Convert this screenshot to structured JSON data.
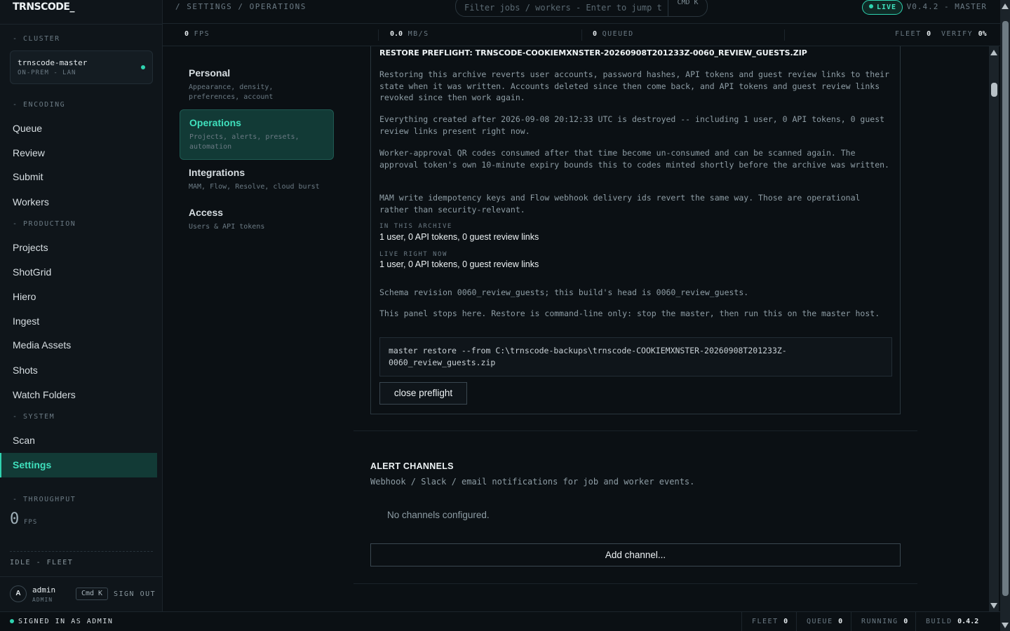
{
  "app": {
    "logo": "TRNSCODE_"
  },
  "sidebar": {
    "cluster_label": "- CLUSTER",
    "cluster_name": "trnscode-master",
    "cluster_sub": "ON-PREM - LAN",
    "encoding_label": "- ENCODING",
    "encoding_items": [
      "Queue",
      "Review",
      "Submit",
      "Workers"
    ],
    "production_label": "- PRODUCTION",
    "production_items": [
      "Projects",
      "ShotGrid",
      "Hiero",
      "Ingest",
      "Media Assets",
      "Shots",
      "Watch Folders"
    ],
    "system_label": "- SYSTEM",
    "system_items": [
      "Scan",
      "Settings"
    ],
    "throughput_label": "- THROUGHPUT",
    "throughput_value": "0",
    "throughput_unit": "FPS",
    "fleet_status": "IDLE - FLEET",
    "user": {
      "initial": "A",
      "name": "admin",
      "role": "ADMIN",
      "shortcut": "Cmd K",
      "signout": "SIGN OUT"
    }
  },
  "topbar": {
    "breadcrumb": "/ SETTINGS / OPERATIONS",
    "search_placeholder": "Filter jobs / workers - Enter to jump t",
    "search_shortcut": "CMD K",
    "live_label": "LIVE",
    "version": "V0.4.2 - MASTER"
  },
  "stats": {
    "fps_value": "0",
    "fps_label": "FPS",
    "mbs_value": "0.0",
    "mbs_label": "MB/S",
    "queued_value": "0",
    "queued_label": "QUEUED",
    "fleet_label": "FLEET",
    "fleet_value": "0",
    "verify_label": "VERIFY",
    "verify_value": "0%"
  },
  "settings_nav": [
    {
      "title": "Personal",
      "sub": "Appearance, density, preferences, account"
    },
    {
      "title": "Operations",
      "sub": "Projects, alerts, presets, automation"
    },
    {
      "title": "Integrations",
      "sub": "MAM, Flow, Resolve, cloud burst"
    },
    {
      "title": "Access",
      "sub": "Users & API tokens"
    }
  ],
  "preflight": {
    "title": "RESTORE PREFLIGHT: TRNSCODE-COOKIEMXNSTER-20260908T201233Z-0060_REVIEW_GUESTS.ZIP",
    "p1": "Restoring this archive reverts user accounts, password hashes, API tokens and guest review links to their state when it was written. Accounts deleted since then come back, and API tokens and guest review links revoked since then work again.",
    "p2": "Everything created after 2026-09-08 20:12:33 UTC is destroyed -- including 1 user, 0 API tokens, 0 guest review links present right now.",
    "p3": "Worker-approval QR codes consumed after that time become un-consumed and can be scanned again. The approval token's own 10-minute expiry bounds this to codes minted shortly before the archive was written.",
    "p4": "MAM write idempotency keys and Flow webhook delivery ids revert the same way. Those are operational rather than security-relevant.",
    "archive_label": "IN THIS ARCHIVE",
    "archive_value": "1 user, 0 API tokens, 0 guest review links",
    "live_label": "LIVE RIGHT NOW",
    "live_value": "1 user, 0 API tokens, 0 guest review links",
    "schema": "Schema revision 0060_review_guests; this build's head is 0060_review_guests.",
    "note": "This panel stops here. Restore is command-line only: stop the master, then run this on the master host.",
    "command": "master restore --from C:\\trnscode-backups\\trnscode-COOKIEMXNSTER-20260908T201233Z-0060_review_guests.zip",
    "close_label": "close preflight"
  },
  "alerts": {
    "title": "ALERT CHANNELS",
    "subtitle": "Webhook / Slack / email notifications for job and worker events.",
    "empty": "No channels configured.",
    "add_label": "Add channel..."
  },
  "footer": {
    "signed_in": "SIGNED IN AS ADMIN",
    "fleet_label": "FLEET",
    "fleet_value": "0",
    "queue_label": "QUEUE",
    "queue_value": "0",
    "running_label": "RUNNING",
    "running_value": "0",
    "build_label": "BUILD",
    "build_value": "0.4.2"
  },
  "colors": {
    "accent": "#2fd3b0",
    "background": "#0b1014",
    "sidebar": "#0f151a",
    "active_bg": "#123a36"
  }
}
